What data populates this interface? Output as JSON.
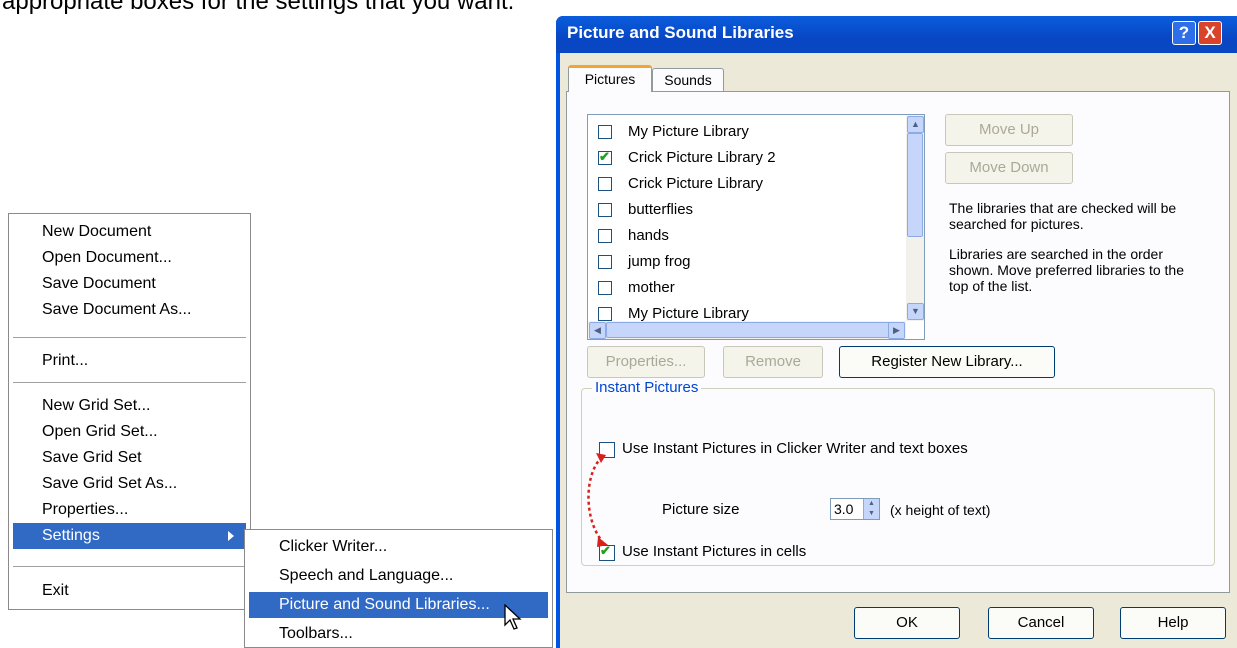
{
  "caption": "appropriate boxes for the settings that you want.",
  "menu": {
    "items": [
      {
        "label": "New Document"
      },
      {
        "label": "Open Document..."
      },
      {
        "label": "Save Document"
      },
      {
        "label": "Save Document As..."
      },
      {
        "label": "Print..."
      },
      {
        "label": "New Grid Set..."
      },
      {
        "label": "Open Grid Set..."
      },
      {
        "label": "Save Grid Set"
      },
      {
        "label": "Save Grid Set As..."
      },
      {
        "label": "Properties..."
      },
      {
        "label": "Settings"
      },
      {
        "label": "Exit"
      }
    ]
  },
  "submenu": {
    "items": [
      {
        "label": "Clicker Writer..."
      },
      {
        "label": "Speech and Language..."
      },
      {
        "label": "Picture and Sound Libraries..."
      },
      {
        "label": "Toolbars..."
      }
    ]
  },
  "dialog": {
    "title": "Picture and Sound Libraries",
    "help_glyph": "?",
    "close_glyph": "X",
    "tabs": [
      {
        "label": "Pictures"
      },
      {
        "label": "Sounds"
      }
    ],
    "libraries": [
      {
        "label": "My Picture Library",
        "checked": false
      },
      {
        "label": "Crick Picture Library 2",
        "checked": true
      },
      {
        "label": "Crick Picture Library",
        "checked": false
      },
      {
        "label": "butterflies",
        "checked": false
      },
      {
        "label": "hands",
        "checked": false
      },
      {
        "label": "jump frog",
        "checked": false
      },
      {
        "label": "mother",
        "checked": false
      },
      {
        "label": "My Picture Library",
        "checked": false
      }
    ],
    "move_up": "Move Up",
    "move_down": "Move Down",
    "info1": "The libraries that are checked will be searched for pictures.",
    "info2": "Libraries are searched in the order shown. Move preferred libraries to the top of the list.",
    "properties_btn": "Properties...",
    "remove_btn": "Remove",
    "register_btn": "Register New Library...",
    "instant": {
      "legend": "Instant Pictures",
      "use_writer_label": "Use Instant Pictures in Clicker Writer and text boxes",
      "use_writer_checked": false,
      "picture_size_label": "Picture size",
      "picture_size_value": "3.0",
      "picture_size_unit": "(x height of text)",
      "use_cells_label": "Use Instant Pictures in cells",
      "use_cells_checked": true
    },
    "ok": "OK",
    "cancel": "Cancel",
    "help": "Help"
  }
}
